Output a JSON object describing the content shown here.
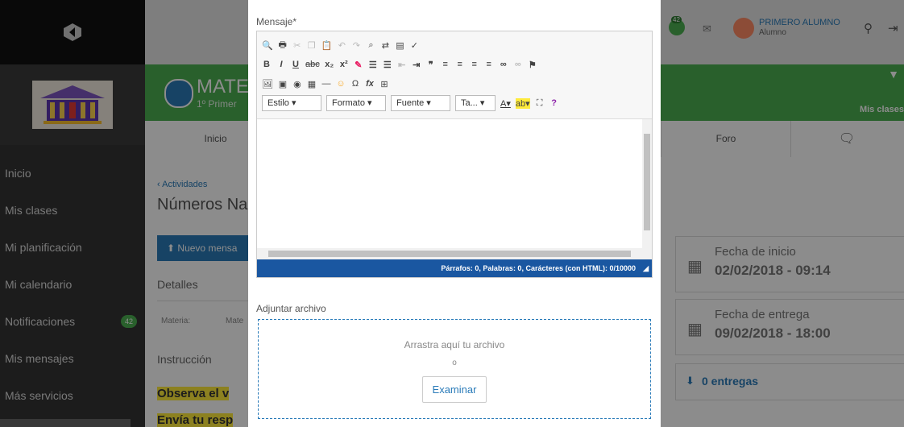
{
  "sidebar": {
    "items": [
      {
        "label": "Inicio"
      },
      {
        "label": "Mis clases"
      },
      {
        "label": "Mi planificación"
      },
      {
        "label": "Mi calendario"
      },
      {
        "label": "Notificaciones",
        "badge": "42"
      },
      {
        "label": "Mis mensajes"
      },
      {
        "label": "Más servicios"
      }
    ]
  },
  "header": {
    "user_name": "PRIMERO ALUMNO",
    "user_role": "Alumno",
    "notif_count": "42"
  },
  "banner": {
    "course_title": "MATE",
    "course_subtitle": "1º Primer",
    "right_label": "Mis clases"
  },
  "tabs": {
    "inicio": "Inicio",
    "foro": "Foro"
  },
  "content": {
    "breadcrumb": "‹ Actividades",
    "title": "Números Na",
    "new_message_btn": "Nuevo mensa",
    "details_heading": "Detalles",
    "materia_label": "Materia:",
    "materia_value": "Mate",
    "instruccion_heading": "Instrucción",
    "highlight_1": "Observa el v",
    "highlight_2": "Envía tu resp"
  },
  "cards": {
    "start_label": "Fecha de inicio",
    "start_value": "02/02/2018 - 09:14",
    "end_label": "Fecha de entrega",
    "end_value": "09/02/2018 - 18:00",
    "deliveries": "0 entregas"
  },
  "modal": {
    "mensaje_label": "Mensaje*",
    "toolbar": {
      "estilo": "Estilo",
      "formato": "Formato",
      "fuente": "Fuente",
      "tamano": "Ta...",
      "help": "?"
    },
    "status_text": "Párrafos: 0, Palabras: 0, Carácteres (con HTML): 0/10000",
    "adjuntar_label": "Adjuntar archivo",
    "drop_text": "Arrastra aquí tu archivo",
    "or_text": "o",
    "examinar_label": "Examinar"
  },
  "colors": {
    "sidebar": "#333333",
    "banner": "#4caf50",
    "status_bar": "#1a57a1",
    "accent_blue": "#2a7bb9",
    "highlight": "#ffeb3b"
  }
}
